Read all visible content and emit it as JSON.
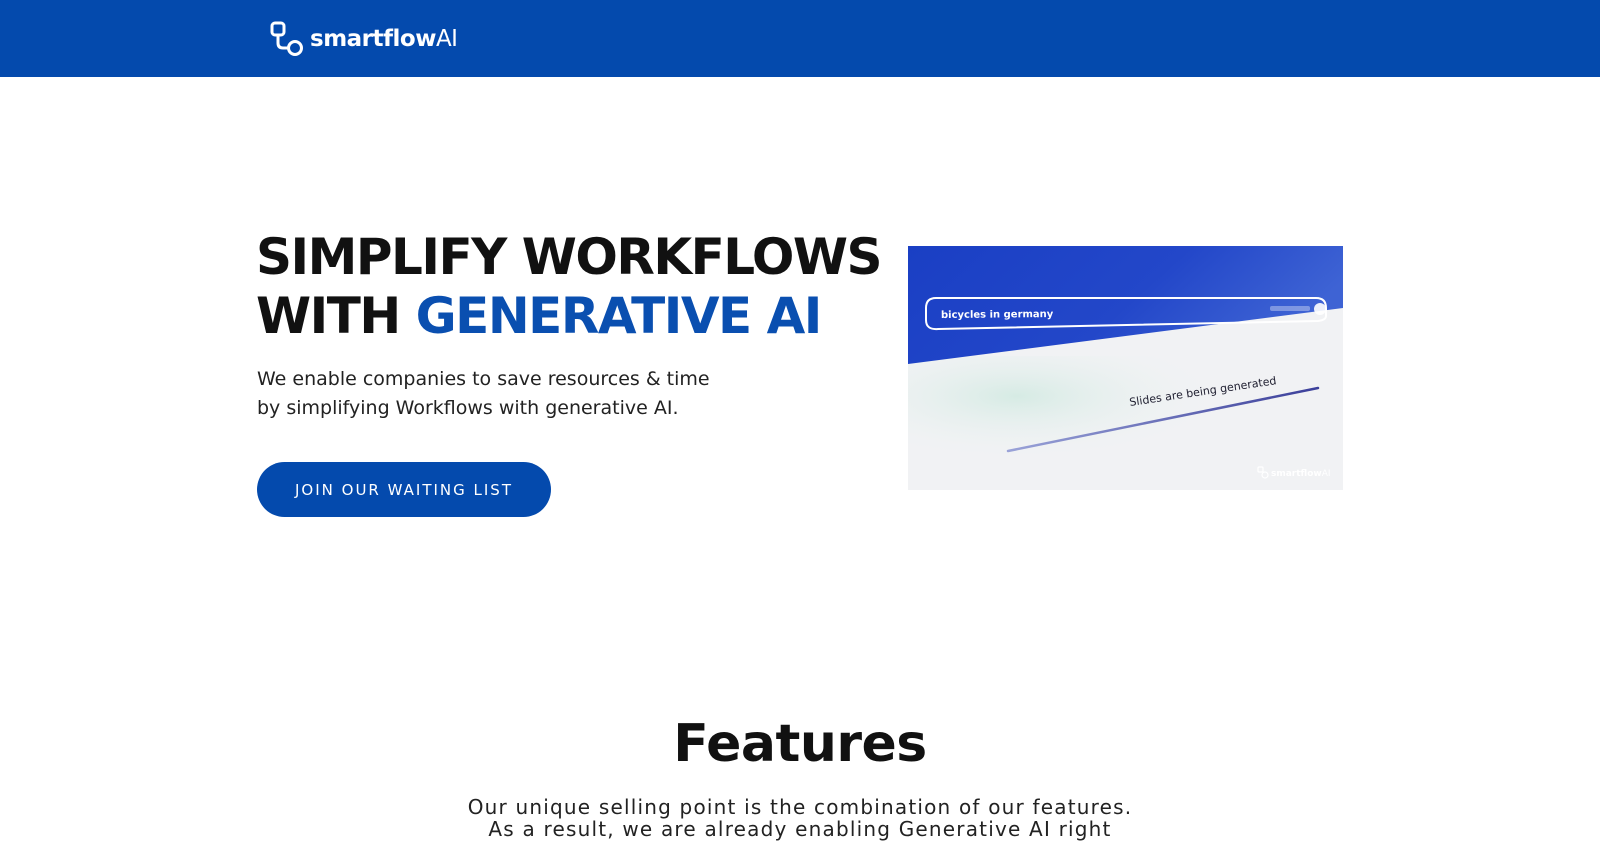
{
  "header": {
    "brand_bold": "smartflow",
    "brand_light": "AI",
    "logo_icon": "flow-nodes-icon"
  },
  "hero": {
    "title_line1": "SIMPLIFY WORKFLOWS",
    "title_line2_prefix": "WITH ",
    "title_line2_accent": "GENERATIVE AI",
    "subtitle_line1": "We enable companies to save resources & time",
    "subtitle_line2": "by simplifying Workflows with generative AI.",
    "cta_label": "JOIN OUR WAITING LIST"
  },
  "hero_image": {
    "search_query": "bicycles in germany",
    "status_text": "Slides are being generated",
    "watermark_bold": "smartflow",
    "watermark_light": "AI"
  },
  "features": {
    "title": "Features",
    "subtitle_line1": "Our unique selling point is the combination of our features.",
    "subtitle_line2": "As a result, we are already enabling Generative AI right"
  },
  "colors": {
    "brand_blue": "#044aad",
    "accent_text": "#0a4fb0",
    "text_dark": "#111111"
  }
}
